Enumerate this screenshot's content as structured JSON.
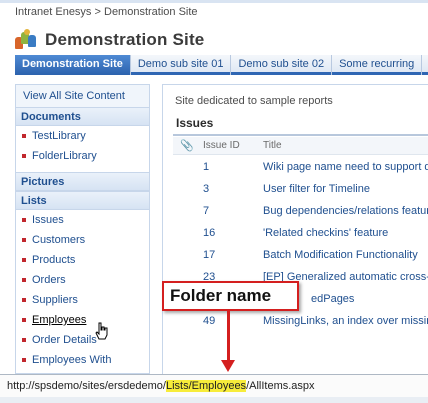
{
  "breadcrumb": {
    "root": "Intranet Enesys",
    "separator": ">",
    "current": "Demonstration Site"
  },
  "site": {
    "title": "Demonstration Site"
  },
  "tabs": [
    {
      "label": "Demonstration Site",
      "active": true
    },
    {
      "label": "Demo sub site 01",
      "active": false
    },
    {
      "label": "Demo sub site 02",
      "active": false
    },
    {
      "label": "Some recurring",
      "active": false
    }
  ],
  "leftnav": {
    "view_all": "View All Site Content",
    "documents": {
      "heading": "Documents",
      "items": [
        "TestLibrary",
        "FolderLibrary"
      ]
    },
    "pictures": {
      "heading": "Pictures"
    },
    "lists": {
      "heading": "Lists",
      "items": [
        "Issues",
        "Customers",
        "Products",
        "Orders",
        "Suppliers",
        "Employees",
        "Order Details",
        "Employees With"
      ]
    }
  },
  "main": {
    "description": "Site dedicated to sample reports",
    "list_title": "Issues",
    "columns": {
      "attachment": "📎",
      "issue_id": "Issue ID",
      "title": "Title"
    },
    "rows": [
      {
        "id": "1",
        "title": "Wiki page name need to support di"
      },
      {
        "id": "3",
        "title": "User filter for Timeline"
      },
      {
        "id": "7",
        "title": "Bug dependencies/relations feature"
      },
      {
        "id": "16",
        "title": "'Related checkins' feature"
      },
      {
        "id": "17",
        "title": "Batch Modification Functionality"
      },
      {
        "id": "23",
        "title": "[EP] Generalized automatic cross-r"
      },
      {
        "id": "",
        "title": "edPages"
      },
      {
        "id": "49",
        "title": "MissingLinks, an index over missing"
      }
    ]
  },
  "callout": {
    "label": "Folder name"
  },
  "statusbar": {
    "url_prefix": "http://spsdemo/sites/ersdedemo/",
    "url_highlight": "Lists/Employees",
    "url_suffix": "/AllItems.aspx"
  },
  "colors": {
    "accent": "#2f66b3",
    "link": "#1f4f8f",
    "bullet": "#c1272d",
    "callout": "#d41f1f",
    "highlight": "#f7ec3a"
  }
}
